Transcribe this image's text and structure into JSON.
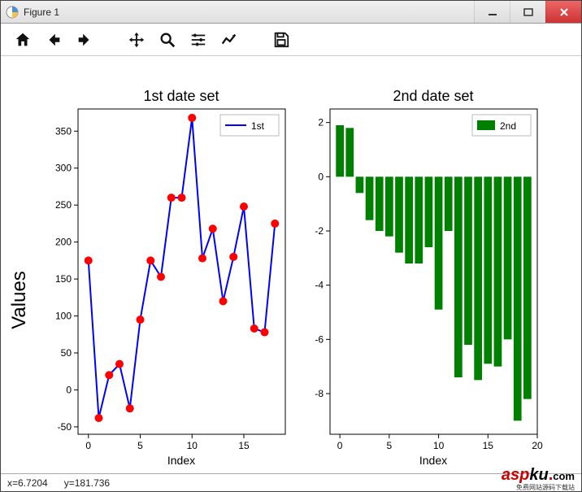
{
  "window": {
    "title": "Figure 1"
  },
  "toolbar": {
    "icons": {
      "home": "home-icon",
      "back": "back-icon",
      "forward": "forward-icon",
      "pan": "pan-icon",
      "zoom": "zoom-icon",
      "config": "subplots-icon",
      "edit": "edit-icon",
      "save": "save-icon"
    }
  },
  "shared": {
    "ylabel": "Values",
    "xlabel": "Index"
  },
  "chart_data": [
    {
      "type": "line",
      "title": "1st date set",
      "xlabel": "Index",
      "x": [
        0,
        1,
        2,
        3,
        4,
        5,
        6,
        7,
        8,
        9,
        10,
        11,
        12,
        13,
        14,
        15,
        16,
        17,
        18
      ],
      "values": [
        175,
        -38,
        20,
        35,
        -25,
        95,
        175,
        153,
        260,
        260,
        368,
        178,
        218,
        120,
        180,
        248,
        83,
        78,
        225
      ],
      "series_name": "1st",
      "xticks": [
        0,
        5,
        10,
        15
      ],
      "yticks": [
        -50,
        0,
        50,
        100,
        150,
        200,
        250,
        300,
        350
      ],
      "xlim": [
        -1,
        19
      ],
      "ylim": [
        -60,
        380
      ]
    },
    {
      "type": "bar",
      "title": "2nd date set",
      "xlabel": "Index",
      "x": [
        0,
        1,
        2,
        3,
        4,
        5,
        6,
        7,
        8,
        9,
        10,
        11,
        12,
        13,
        14,
        15,
        16,
        17,
        18,
        19
      ],
      "values": [
        1.9,
        1.8,
        -0.6,
        -1.6,
        -2.0,
        -2.2,
        -2.8,
        -3.2,
        -3.2,
        -2.6,
        -4.9,
        -2.0,
        -7.4,
        -6.2,
        -7.5,
        -6.9,
        -7.0,
        -6.0,
        -9.0,
        -8.2
      ],
      "series_name": "2nd",
      "xticks": [
        0,
        5,
        10,
        15,
        20
      ],
      "yticks": [
        -8,
        -6,
        -4,
        -2,
        0,
        2
      ],
      "xlim": [
        -1,
        20
      ],
      "ylim": [
        -9.5,
        2.5
      ]
    }
  ],
  "status": {
    "x_label": "x=6.7204",
    "y_label": "y=181.736"
  },
  "brand": {
    "asp": "asp",
    "ku": "ku",
    "dot": ".",
    "com": "com",
    "tagline": "免费网站源码下载站"
  }
}
